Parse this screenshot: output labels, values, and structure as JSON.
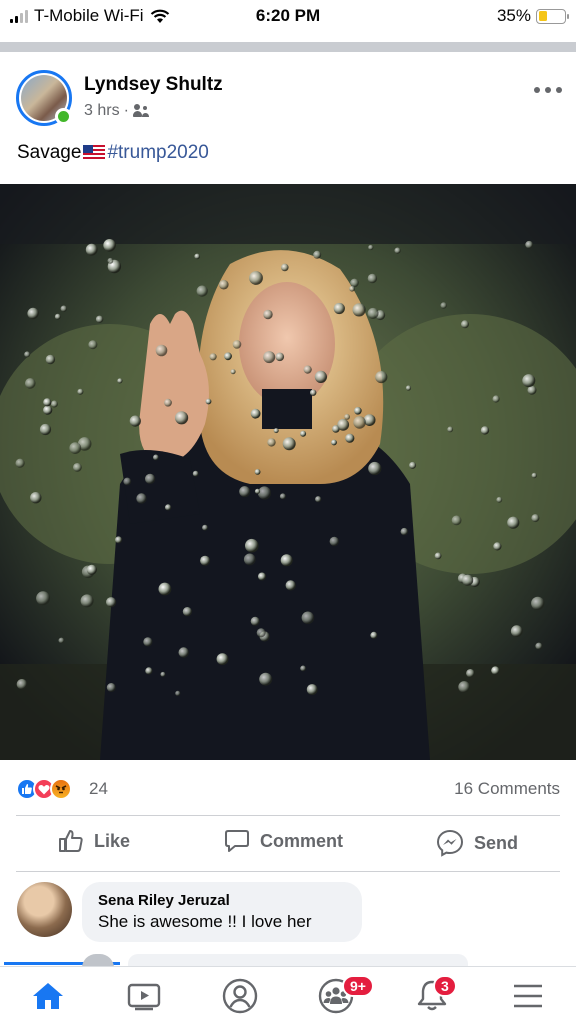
{
  "status_bar": {
    "carrier": "T-Mobile Wi-Fi",
    "time": "6:20 PM",
    "battery": "35%",
    "battery_level": 0.35
  },
  "post": {
    "author": "Lyndsey Shultz",
    "time": "3 hrs",
    "separator": "·",
    "text": "Savage",
    "hashtag": "#trump2020",
    "audience_icon": "friends-icon",
    "more_icon": "ellipsis-icon",
    "photo_alt": "photo"
  },
  "reactions": {
    "types": [
      "like",
      "love",
      "angry"
    ],
    "count": "24",
    "comments": "16 Comments"
  },
  "actions": {
    "like": "Like",
    "comment": "Comment",
    "send": "Send"
  },
  "comments": [
    {
      "author": "Sena Riley Jeruzal",
      "text": "She is awesome !! I love her"
    }
  ],
  "bottom_nav": {
    "items": [
      "home-icon",
      "watch-icon",
      "profile-icon",
      "groups-icon",
      "notifications-icon",
      "menu-icon"
    ],
    "groups_badge": "9+",
    "notifications_badge": "3"
  },
  "colors": {
    "facebook_blue": "#1877f2",
    "hashtag": "#385898",
    "secondary_text": "#65676b",
    "badge_red": "#e41e3f"
  }
}
